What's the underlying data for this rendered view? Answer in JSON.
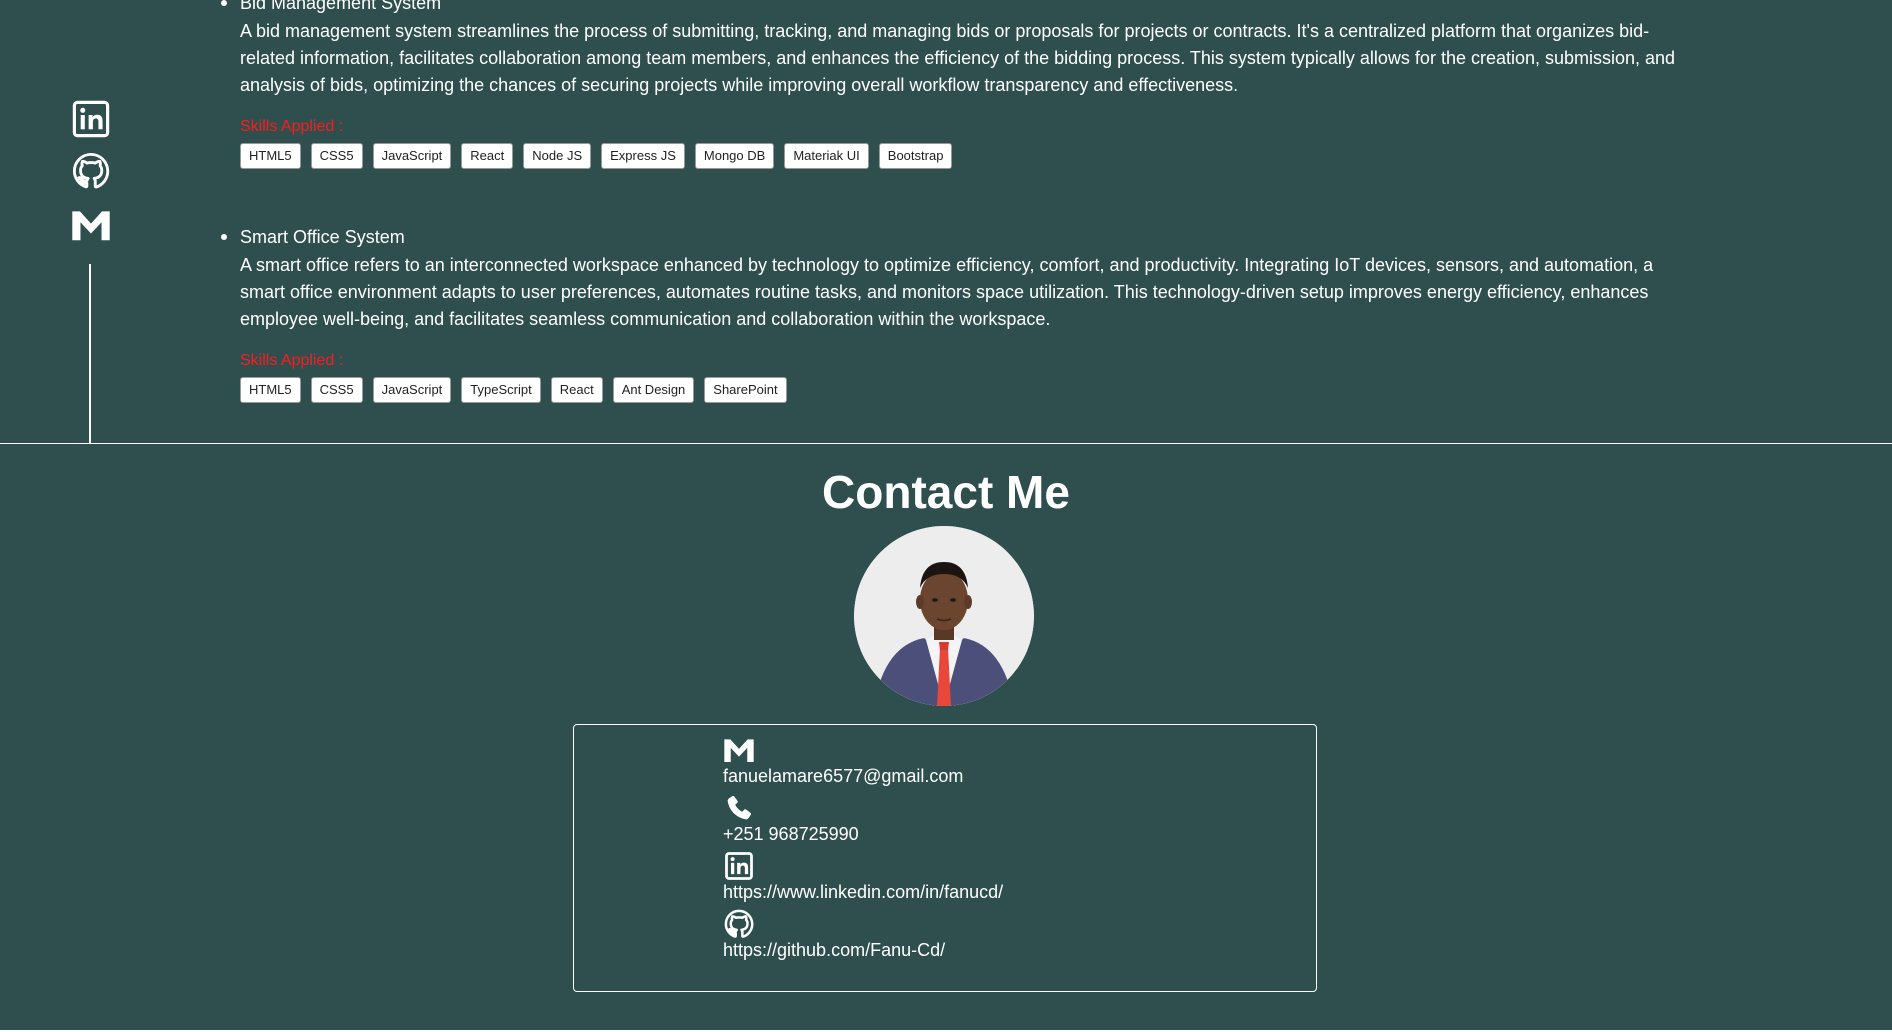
{
  "rail": {
    "icons": [
      "linkedin-icon",
      "github-icon",
      "gmail-icon"
    ]
  },
  "projects": [
    {
      "title": "Bid Management System",
      "description": "A bid management system streamlines the process of submitting, tracking, and managing bids or proposals for projects or contracts. It's a centralized platform that organizes bid-related information, facilitates collaboration among team members, and enhances the efficiency of the bidding process. This system typically allows for the creation, submission, and analysis of bids, optimizing the chances of securing projects while improving overall workflow transparency and effectiveness.",
      "skills_label": "Skills Applied :",
      "skills": [
        "HTML5",
        "CSS5",
        "JavaScript",
        "React",
        "Node JS",
        "Express JS",
        "Mongo DB",
        "Materiak UI",
        "Bootstrap"
      ]
    },
    {
      "title": "Smart Office System",
      "description": "A smart office refers to an interconnected workspace enhanced by technology to optimize efficiency, comfort, and productivity. Integrating IoT devices, sensors, and automation, a smart office environment adapts to user preferences, automates routine tasks, and monitors space utilization. This technology-driven setup improves energy efficiency, enhances employee well-being, and facilitates seamless communication and collaboration within the workspace.",
      "skills_label": "Skills Applied :",
      "skills": [
        "HTML5",
        "CSS5",
        "JavaScript",
        "TypeScript",
        "React",
        "Ant Design",
        "SharePoint"
      ]
    }
  ],
  "contact": {
    "title": "Contact Me",
    "email": "fanuelamare6577@gmail.com",
    "phone": "+251 968725990",
    "linkedin": "https://www.linkedin.com/in/fanucd/",
    "github": "https://github.com/Fanu-Cd/"
  },
  "colors": {
    "background": "#2f4f4f",
    "skills_label": "#ff1a1a",
    "text": "#ffffff"
  }
}
